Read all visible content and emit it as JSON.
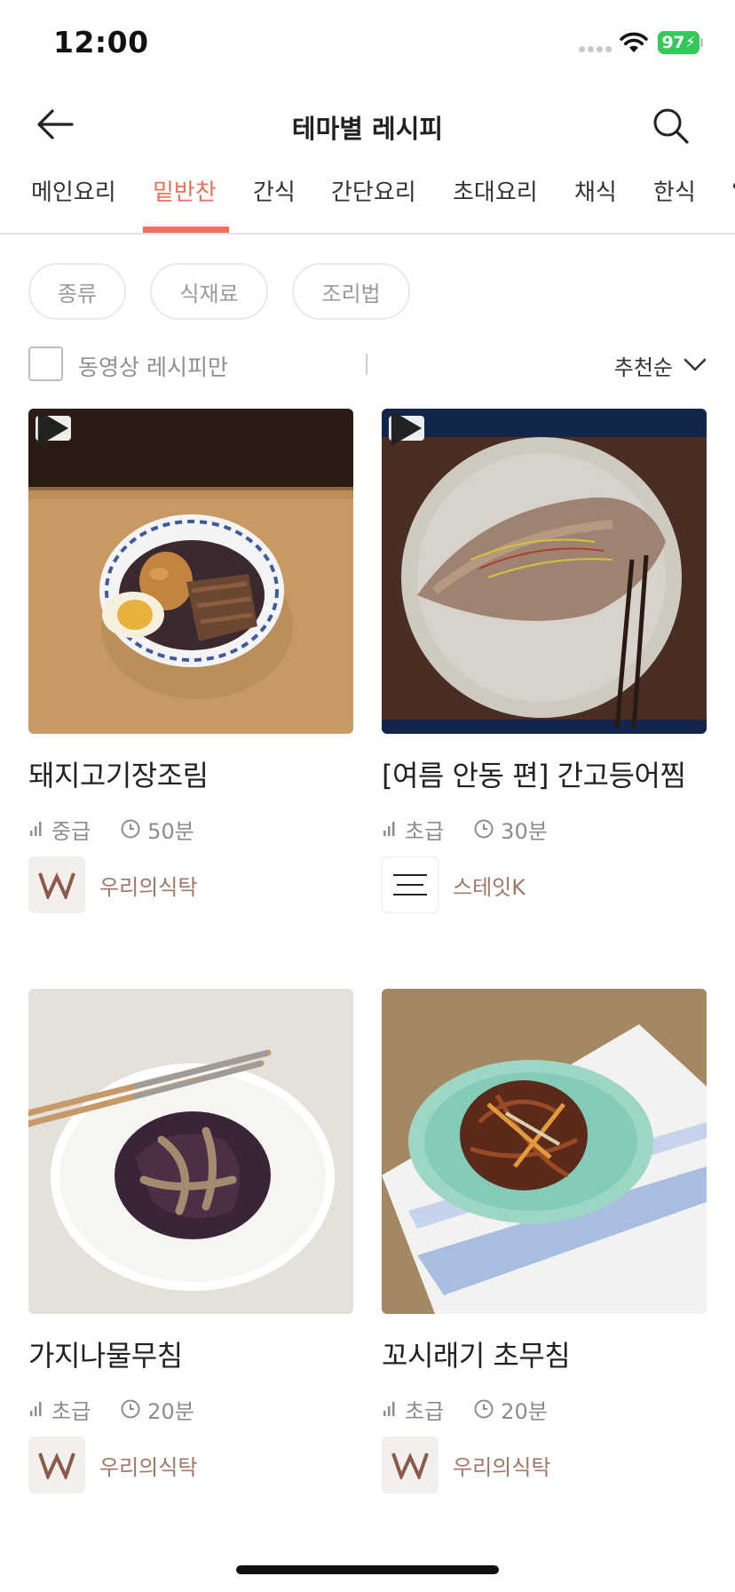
{
  "status_bar": {
    "time": "12:00",
    "battery": "97"
  },
  "header": {
    "title": "테마별 레시피"
  },
  "tabs": [
    {
      "label": "메인요리",
      "active": false
    },
    {
      "label": "밑반찬",
      "active": true
    },
    {
      "label": "간식",
      "active": false
    },
    {
      "label": "간단요리",
      "active": false
    },
    {
      "label": "초대요리",
      "active": false
    },
    {
      "label": "채식",
      "active": false
    },
    {
      "label": "한식",
      "active": false
    }
  ],
  "filters": {
    "chips": [
      "종류",
      "식재료",
      "조리법"
    ]
  },
  "options": {
    "video_only_label": "동영상 레시피만",
    "video_only_checked": false,
    "sort_label": "추천순"
  },
  "recipes": [
    {
      "title": "돼지고기장조림",
      "level": "중급",
      "time": "50분",
      "author": "우리의식탁",
      "video": true
    },
    {
      "title": "[여름 안동 편] 간고등어찜",
      "level": "초급",
      "time": "30분",
      "author": "스테잇K",
      "video": true
    },
    {
      "title": "가지나물무침",
      "level": "초급",
      "time": "20분",
      "author": "우리의식탁",
      "video": false
    },
    {
      "title": "꼬시래기 초무침",
      "level": "초급",
      "time": "20분",
      "author": "우리의식탁",
      "video": false
    }
  ],
  "colors": {
    "accent": "#ee6f5a",
    "author_text": "#a27767",
    "battery": "#34c759"
  }
}
